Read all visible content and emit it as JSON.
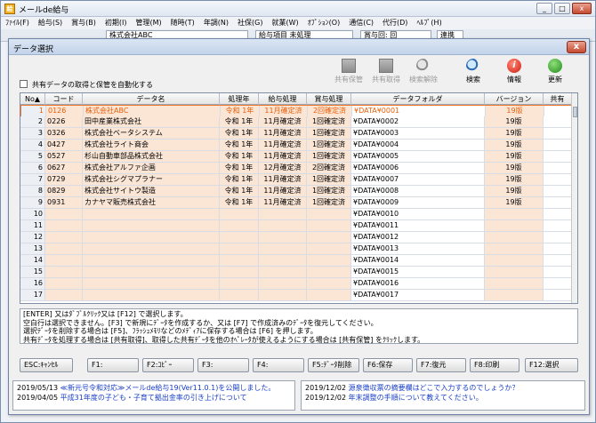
{
  "app": {
    "title": "メールde給与",
    "logo_text": "給",
    "window_controls": [
      "_",
      "□",
      "x"
    ],
    "menu": [
      "ﾌｧｲﾙ(F)",
      "給与(S)",
      "賞与(B)",
      "初期(I)",
      "管理(M)",
      "随時(T)",
      "年調(N)",
      "社保(G)",
      "就業(W)",
      "ｵﾌﾟｼｮﾝ(O)",
      "通信(C)",
      "代行(D)",
      "ﾍﾙﾌﾟ(H)"
    ],
    "toolbar": {
      "company": "株式会社ABC",
      "pay_item": "給与項目 未処理",
      "bonus": "賞与回: 回",
      "link": "連携"
    }
  },
  "dialog": {
    "title": "データ選択",
    "close_label": "x",
    "auto_checkbox_label": "共有データの取得と保管を自動化する",
    "actions": [
      {
        "name": "shared-save",
        "label": "共有保管",
        "enabled": false,
        "icon": "doc-icon"
      },
      {
        "name": "shared-get",
        "label": "共有取得",
        "enabled": false,
        "icon": "doc-icon"
      },
      {
        "name": "search-clear",
        "label": "検索解除",
        "enabled": false,
        "icon": "magnifier-icon"
      },
      {
        "name": "search",
        "label": "検索",
        "enabled": true,
        "icon": "magnifier-icon"
      },
      {
        "name": "info",
        "label": "情報",
        "enabled": true,
        "icon": "info-icon"
      },
      {
        "name": "refresh",
        "label": "更新",
        "enabled": true,
        "icon": "refresh-icon"
      }
    ]
  },
  "grid": {
    "columns": [
      "No▲",
      "コード",
      "データ名",
      "処理年",
      "給与処理",
      "賞与処理",
      "データフォルダ",
      "バージョン",
      "共有"
    ],
    "rows": [
      {
        "no": "1",
        "code": "0126",
        "name": "株式会社ABC",
        "year": "令和  1年",
        "pay": "11月確定済",
        "bonus": "2回確定済",
        "folder": "¥DATA¥0001",
        "version": "19版",
        "selected": true
      },
      {
        "no": "2",
        "code": "0226",
        "name": "田中産業株式会社",
        "year": "令和  1年",
        "pay": "11月確定済",
        "bonus": "1回確定済",
        "folder": "¥DATA¥0002",
        "version": "19版"
      },
      {
        "no": "3",
        "code": "0326",
        "name": "株式会社ベータシステム",
        "year": "令和  1年",
        "pay": "11月確定済",
        "bonus": "1回確定済",
        "folder": "¥DATA¥0003",
        "version": "19版"
      },
      {
        "no": "4",
        "code": "0427",
        "name": "株式会社ライト商会",
        "year": "令和  1年",
        "pay": "11月確定済",
        "bonus": "1回確定済",
        "folder": "¥DATA¥0004",
        "version": "19版"
      },
      {
        "no": "5",
        "code": "0527",
        "name": "杉山自動車部品株式会社",
        "year": "令和  1年",
        "pay": "11月確定済",
        "bonus": "1回確定済",
        "folder": "¥DATA¥0005",
        "version": "19版"
      },
      {
        "no": "6",
        "code": "0627",
        "name": "株式会社アルファ企画",
        "year": "令和  1年",
        "pay": "12月確定済",
        "bonus": "2回確定済",
        "folder": "¥DATA¥0006",
        "version": "19版"
      },
      {
        "no": "7",
        "code": "0729",
        "name": "株式会社シグマプラナー",
        "year": "令和  1年",
        "pay": "11月確定済",
        "bonus": "1回確定済",
        "folder": "¥DATA¥0007",
        "version": "19版"
      },
      {
        "no": "8",
        "code": "0829",
        "name": "株式会社サイトウ製造",
        "year": "令和  1年",
        "pay": "11月確定済",
        "bonus": "1回確定済",
        "folder": "¥DATA¥0008",
        "version": "19版"
      },
      {
        "no": "9",
        "code": "0931",
        "name": "カナヤマ販売株式会社",
        "year": "令和  1年",
        "pay": "11月確定済",
        "bonus": "1回確定済",
        "folder": "¥DATA¥0009",
        "version": "19版"
      },
      {
        "no": "10",
        "folder": "¥DATA¥0010"
      },
      {
        "no": "11",
        "folder": "¥DATA¥0011"
      },
      {
        "no": "12",
        "folder": "¥DATA¥0012"
      },
      {
        "no": "13",
        "folder": "¥DATA¥0013"
      },
      {
        "no": "14",
        "folder": "¥DATA¥0014"
      },
      {
        "no": "15",
        "folder": "¥DATA¥0015"
      },
      {
        "no": "16",
        "folder": "¥DATA¥0016"
      },
      {
        "no": "17",
        "folder": "¥DATA¥0017"
      }
    ]
  },
  "help_lines": [
    "[ENTER] 又はﾀﾞﾌﾞﾙｸﾘｯｸ又は [F12] で選択します。",
    "空白行は選択できません。[F3] で新規にﾃﾞｰﾀを作成するか、又は [F7] で作成済みのﾃﾞｰﾀを復元してください。",
    "選択ﾃﾞｰﾀを削除する場合は [F5]、ﾌﾗｯｼｭﾒﾓﾘなどのﾒﾃﾞｨｱに保存する場合は [F6] を押します。",
    "共有ﾃﾞｰﾀを処理する場合は [共有取得]、取得した共有ﾃﾞｰﾀを他のｵﾍﾟﾚｰﾀが使えるようにする場合は [共有保管] をｸﾘｯｸします。"
  ],
  "fkeys": [
    "ESC:ｷｬﾝｾﾙ",
    "F1:",
    "F2:ｺﾋﾟｰ",
    "F3:",
    "F4:",
    "F5:ﾃﾞｰﾀ削除",
    "F6:保存",
    "F7:復元",
    "F8:印刷",
    "F12:選択"
  ],
  "news_left": [
    {
      "date": "2019/05/13",
      "text": "≪新元号令和対応≫メールde給与19(Ver11.0.1)を公開しました。"
    },
    {
      "date": "2019/04/05",
      "text": "平成31年度の子ども・子育て拠出金率の引き上げについて"
    }
  ],
  "news_right": [
    {
      "date": "2019/12/02",
      "text": "源泉徴収票の摘要欄はどこで入力するのでしょうか？"
    },
    {
      "date": "2019/12/02",
      "text": "年末調整の手順について教えてください。"
    }
  ]
}
